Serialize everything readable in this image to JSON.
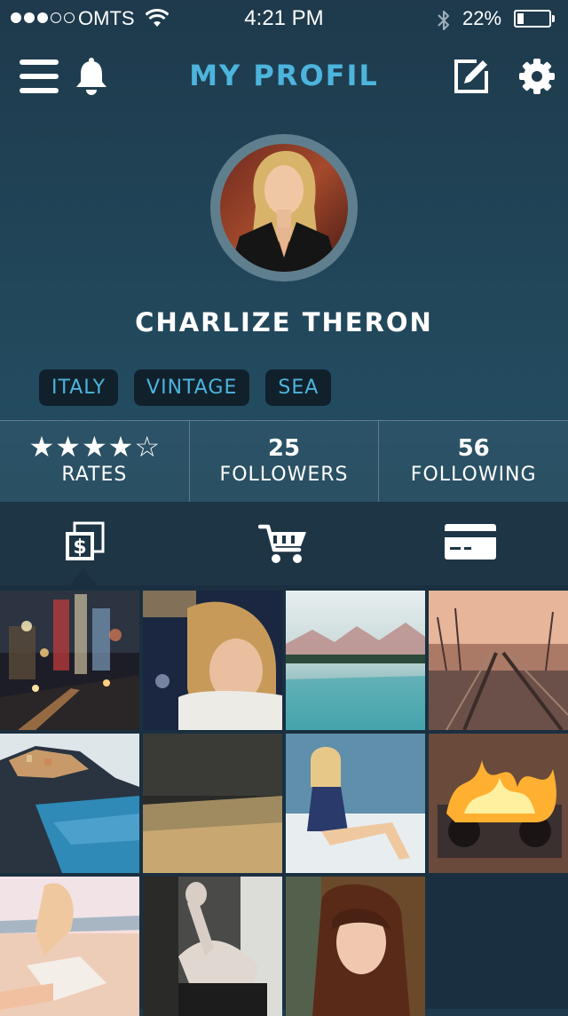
{
  "status_bar": {
    "carrier": "OMTS",
    "time": "4:21 PM",
    "battery_percent": "22%",
    "battery_level": 0.22,
    "signal_bars_filled": 3,
    "signal_bars_total": 5
  },
  "nav": {
    "title": "MY PROFIL",
    "icons": [
      "menu-icon",
      "bell-icon",
      "edit-icon",
      "gear-icon"
    ]
  },
  "profile": {
    "name": "CHARLIZE THERON",
    "tags": [
      "ITALY",
      "VINTAGE",
      "SEA"
    ]
  },
  "stats": {
    "rating_stars": 4,
    "rating_max": 5,
    "rates_label": "RATES",
    "followers_count": "25",
    "followers_label": "FOLLOWERS",
    "following_count": "56",
    "following_label": "FOLLOWING"
  },
  "tabs": {
    "items": [
      "photos-money-icon",
      "cart-icon",
      "credit-card-icon"
    ],
    "selected": "photos-money-icon"
  },
  "colors": {
    "accent": "#4db4dd",
    "background": "#1e3a4c",
    "tag_bg": "#10212c"
  },
  "photos": [
    "city-street-night",
    "woman-blonde-portrait",
    "mountain-lake",
    "railway-tracks",
    "coastal-village",
    "wheat-field",
    "woman-sitting-wall",
    "burning-boombox",
    "woman-on-beach",
    "tattooed-woman",
    "woman-brunette-portrait"
  ]
}
